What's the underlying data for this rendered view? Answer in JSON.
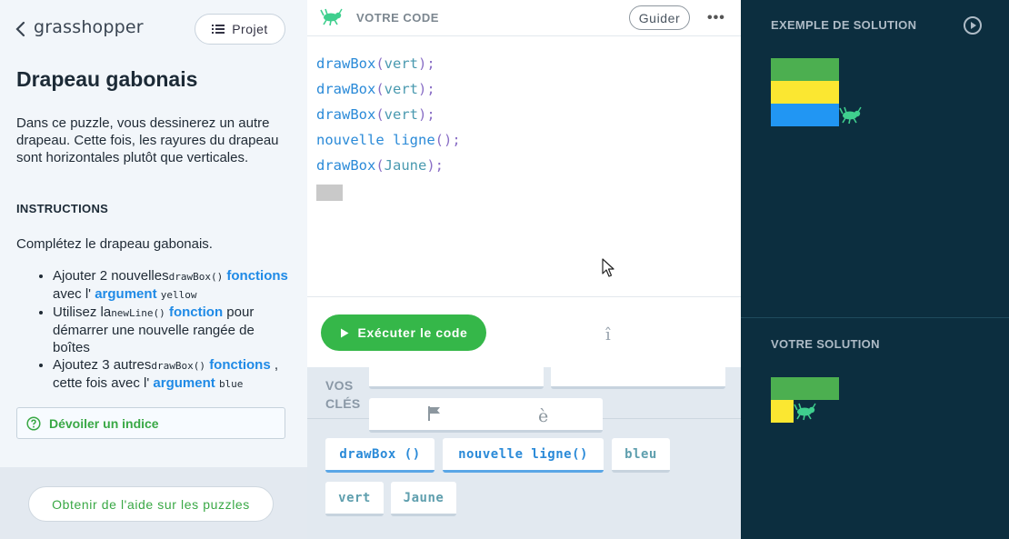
{
  "left": {
    "logo": "grasshopper",
    "projet_label": "Projet",
    "title": "Drapeau gabonais",
    "description": "Dans ce puzzle, vous dessinerez un autre drapeau. Cette fois, les rayures du drapeau sont horizontales plutôt que verticales.",
    "instructions_heading": "INSTRUCTIONS",
    "instructions_intro": "Complétez le drapeau gabonais.",
    "bullets": [
      {
        "a": "Ajouter 2 nouvelles",
        "code1": "drawBox()",
        "kw1": "fonctions",
        "b": " avec l' ",
        "kw2": "argument",
        "code2": "yellow"
      },
      {
        "a": "Utilisez la",
        "code1": "newLine()",
        "kw1": "fonction",
        "b": " pour démarrer une nouvelle rangée de boîtes"
      },
      {
        "a": "Ajoutez 3 autres",
        "code1": "drawBox()",
        "kw1": "fonctions",
        "b": " , cette fois avec l' ",
        "kw2": "argument",
        "code2": "blue"
      }
    ],
    "hint_label": "Dévoiler un indice",
    "help_label": "Obtenir de l'aide sur les puzzles"
  },
  "center": {
    "header_title": "VOTRE CODE",
    "guider_label": "Guider",
    "more_label": "•••",
    "code_lines": [
      {
        "fn": "drawBox",
        "open": "(",
        "arg": "vert",
        "close": ");"
      },
      {
        "fn": "drawBox",
        "open": "(",
        "arg": "vert",
        "close": ");"
      },
      {
        "fn": "drawBox",
        "open": "(",
        "arg": "vert",
        "close": ");"
      },
      {
        "fn": "nouvelle ligne",
        "open": "(",
        "arg": "",
        "close": ");"
      },
      {
        "fn": "drawBox",
        "open": "(",
        "arg": "Jaune",
        "close": ");"
      }
    ],
    "run_label": "Exécuter le code",
    "i_glyph": "î",
    "keys_label_1": "VOS",
    "keys_label_2": "CLÉS",
    "tab_e": "è",
    "keys": [
      {
        "label": "drawBox ()",
        "kind": "fn"
      },
      {
        "label": "nouvelle ligne()",
        "kind": "fn"
      },
      {
        "label": "bleu",
        "kind": "val"
      },
      {
        "label": "vert",
        "kind": "val"
      },
      {
        "label": "Jaune",
        "kind": "val"
      }
    ]
  },
  "right": {
    "example_title": "EXEMPLE DE SOLUTION",
    "yours_title": "VOTRE SOLUTION",
    "colors": {
      "green": "#4caf50",
      "yellow": "#fbe731",
      "blue": "#2196f3",
      "bg": "#0c2e3f"
    },
    "example_rows": [
      "green",
      "yellow",
      "blue"
    ],
    "yours_rows": [
      "green",
      "yellow"
    ]
  },
  "theme": {
    "accent": "#35b749",
    "code_fn": "#2a8ad8"
  }
}
